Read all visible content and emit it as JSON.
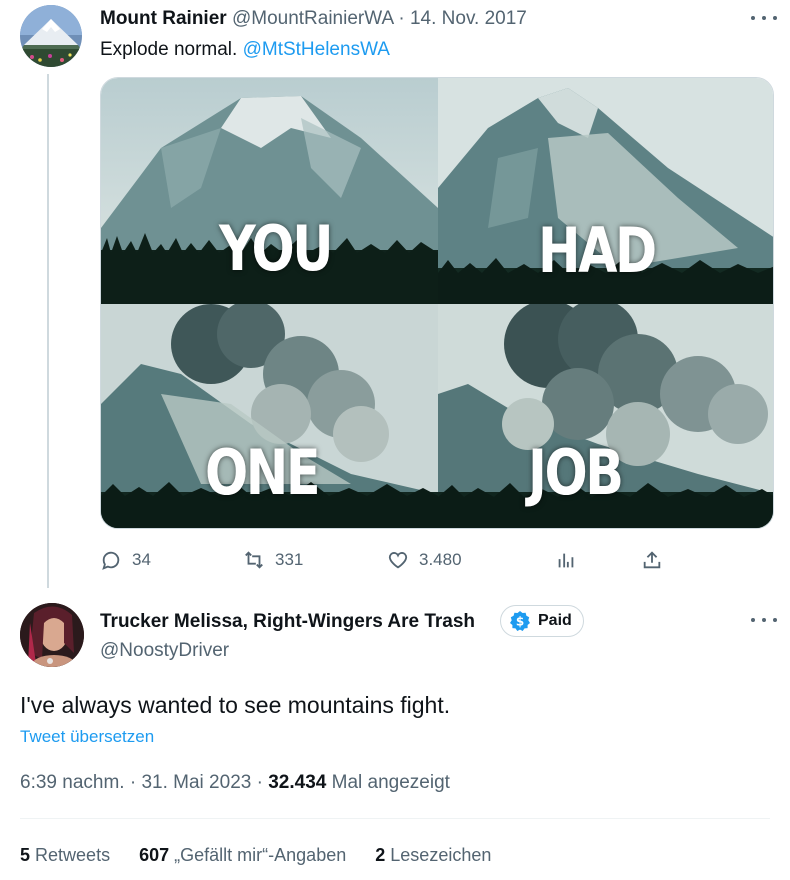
{
  "tweet1": {
    "author_name": "Mount Rainier",
    "handle": "@MountRainierWA",
    "separator": "·",
    "date": "14. Nov. 2017",
    "text": "Explode normal.",
    "mention": "@MtStHelensWA",
    "media_words": [
      "YOU",
      "HAD",
      "ONE",
      "JOB"
    ],
    "actions": {
      "replies": "34",
      "retweets": "331",
      "likes": "3.480"
    }
  },
  "tweet2": {
    "author_name": "Trucker Melissa, Right-Wingers Are Trash",
    "badge_label": "Paid",
    "handle": "@NoostyDriver",
    "text": "I've always wanted to see mountains fight.",
    "translate_label": "Tweet übersetzen",
    "time": "6:39 nachm.",
    "separator": "·",
    "date": "31. Mai 2023",
    "views_count": "32.434",
    "views_label": "Mal angezeigt",
    "stats": {
      "retweets_count": "5",
      "retweets_label": "Retweets",
      "likes_count": "607",
      "likes_label": "„Gefällt mir“-Angaben",
      "bookmarks_count": "2",
      "bookmarks_label": "Lesezeichen"
    }
  },
  "colors": {
    "accent": "#1d9bf0",
    "secondary_text": "#536471",
    "primary_text": "#0f1419"
  },
  "icons": [
    "more-icon",
    "reply-icon",
    "retweet-icon",
    "like-icon",
    "analytics-icon",
    "share-icon",
    "dollar-icon"
  ]
}
